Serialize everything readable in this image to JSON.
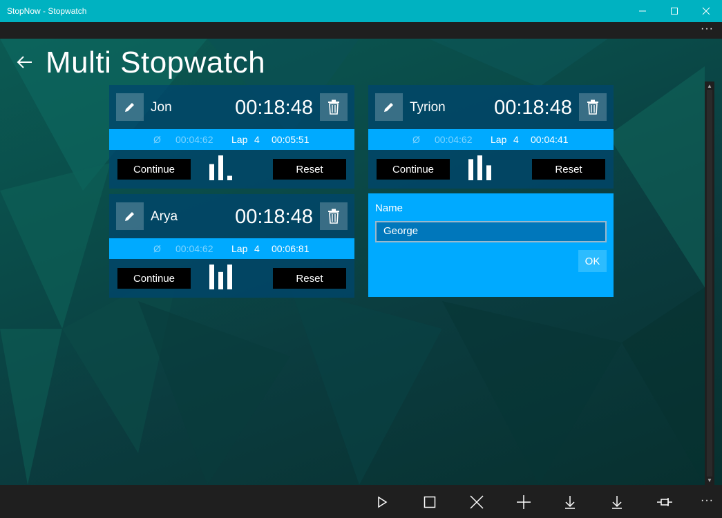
{
  "window": {
    "title": "StopNow - Stopwatch",
    "more_label": "···"
  },
  "header": {
    "title": "Multi Stopwatch"
  },
  "colors": {
    "titlebar": "#00b2c1",
    "accent": "#00aaff",
    "card_bg": "#00466e",
    "button_bg": "#000000"
  },
  "stopwatches": [
    {
      "name": "Jon",
      "time": "00:18:48",
      "avg_icon": "Ø",
      "avg": "00:04:62",
      "lap_label": "Lap",
      "lap_num": "4",
      "lap_time": "00:05:51",
      "continue_label": "Continue",
      "reset_label": "Reset",
      "lap_bars": [
        0.65,
        1.0,
        0.18
      ]
    },
    {
      "name": "Tyrion",
      "time": "00:18:48",
      "avg_icon": "Ø",
      "avg": "00:04:62",
      "lap_label": "Lap",
      "lap_num": "4",
      "lap_time": "00:04:41",
      "continue_label": "Continue",
      "reset_label": "Reset",
      "lap_bars": [
        0.85,
        1.0,
        0.6
      ]
    },
    {
      "name": "Arya",
      "time": "00:18:48",
      "avg_icon": "Ø",
      "avg": "00:04:62",
      "lap_label": "Lap",
      "lap_num": "4",
      "lap_time": "00:06:81",
      "continue_label": "Continue",
      "reset_label": "Reset",
      "lap_bars": [
        1.0,
        0.7,
        1.0
      ]
    }
  ],
  "name_dialog": {
    "label": "Name",
    "value": "George",
    "ok_label": "OK"
  },
  "bottom_bar": {
    "icons": [
      "play-icon",
      "stop-icon",
      "close-icon",
      "add-icon",
      "download-icon",
      "download-icon",
      "pin-icon"
    ],
    "more_label": "···"
  }
}
